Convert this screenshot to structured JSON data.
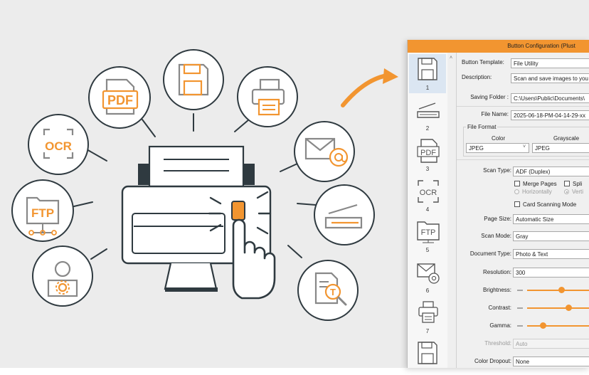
{
  "colors": {
    "accent": "#f29530",
    "stroke": "#2f3a40",
    "background": "#ececec"
  },
  "illustration": {
    "icons": [
      "save-icon",
      "pdf-icon",
      "ocr-icon",
      "ftp-icon",
      "user-gear-icon",
      "printer-icon",
      "email-icon",
      "scanner-icon",
      "document-text-icon",
      "multifunction-printer-icon",
      "pointing-hand-icon",
      "arrow-icon"
    ],
    "pdf_text": "PDF",
    "ocr_text": "OCR",
    "ftp_text": "FTP",
    "text_tool_text": "T"
  },
  "window": {
    "title": "Button Configuration (Plust",
    "sidebar": {
      "buttons": [
        {
          "number": "1",
          "icon": "save-icon"
        },
        {
          "number": "2",
          "icon": "scanner-icon"
        },
        {
          "number": "3",
          "icon": "pdf-icon",
          "text": "PDF"
        },
        {
          "number": "4",
          "icon": "ocr-icon",
          "text": "OCR"
        },
        {
          "number": "5",
          "icon": "ftp-icon",
          "text": "FTP"
        },
        {
          "number": "6",
          "icon": "email-icon"
        },
        {
          "number": "7",
          "icon": "printer-icon"
        }
      ]
    },
    "form": {
      "button_template_label": "Button Template:",
      "button_template_value": "File Utility",
      "description_label": "Description:",
      "description_value": "Scan and save images to you",
      "saving_folder_label": "Saving Folder :",
      "saving_folder_value": "C:\\Users\\Public\\Documents\\",
      "file_name_label": "File Name:",
      "file_name_value": "2025-06-18-PM-04-14-29-xx",
      "file_format_label": "File Format",
      "color_label": "Color",
      "grayscale_label": "Grayscale",
      "color_value": "JPEG",
      "grayscale_value": "JPEG",
      "scan_type_label": "Scan Type:",
      "scan_type_value": "ADF (Duplex)",
      "merge_pages_label": "Merge Pages",
      "split_label": "Spli",
      "horizontally_label": "Horizontally",
      "vertically_label": "Verti",
      "card_scanning_label": "Card Scanning Mode",
      "page_size_label": "Page Size:",
      "page_size_value": "Automatic Size",
      "scan_mode_label": "Scan Mode:",
      "scan_mode_value": "Gray",
      "document_type_label": "Document Type:",
      "document_type_value": "Photo & Text",
      "resolution_label": "Resolution:",
      "resolution_value": "300",
      "brightness_label": "Brightness:",
      "contrast_label": "Contrast:",
      "gamma_label": "Gamma:",
      "threshold_label": "Threshold:",
      "threshold_value": "Auto",
      "color_dropout_label": "Color Dropout:",
      "color_dropout_value": "None"
    }
  }
}
